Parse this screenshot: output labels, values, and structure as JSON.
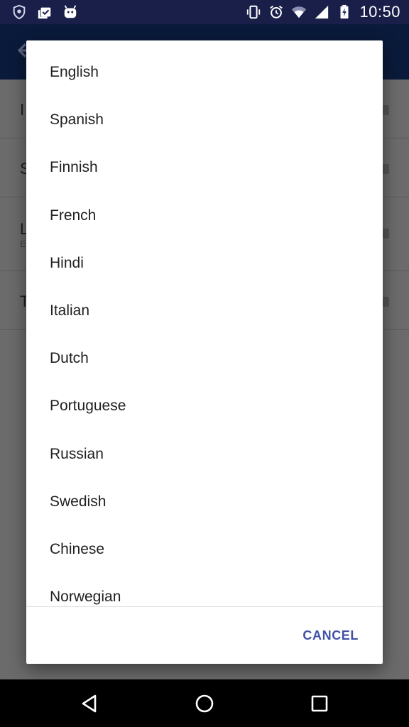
{
  "status_bar": {
    "time": "10:50",
    "left_icons": [
      "vpn-shield-icon",
      "clipboard-check-icon",
      "android-robot-icon"
    ],
    "right_icons": [
      "vibrate-icon",
      "alarm-icon",
      "wifi-icon",
      "cell-signal-icon",
      "battery-charging-icon"
    ]
  },
  "background_screen": {
    "items": [
      {
        "title_partial": "I",
        "subtitle_partial": ""
      },
      {
        "title_partial": "S",
        "subtitle_partial": ""
      },
      {
        "title_partial": "L",
        "subtitle_partial": "E"
      },
      {
        "title_partial": "T",
        "subtitle_partial": ""
      }
    ]
  },
  "dialog": {
    "options": [
      "English",
      "Spanish",
      "Finnish",
      "French",
      "Hindi",
      "Italian",
      "Dutch",
      "Portuguese",
      "Russian",
      "Swedish",
      "Chinese",
      "Norwegian"
    ],
    "cancel_label": "CANCEL",
    "accent_color": "#3f51a5"
  },
  "nav_bar": {
    "buttons": [
      "back",
      "home",
      "recents"
    ]
  }
}
